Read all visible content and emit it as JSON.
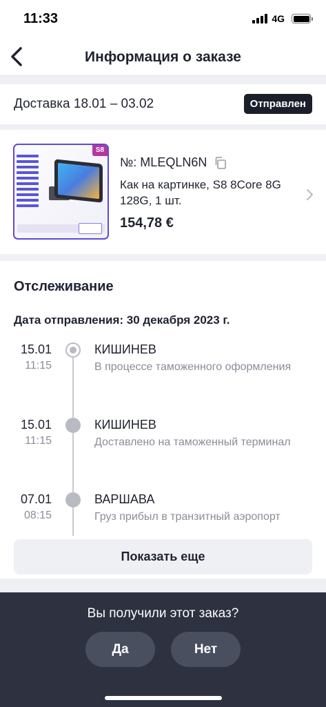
{
  "status_bar": {
    "time": "11:33",
    "network": "4G"
  },
  "nav": {
    "title": "Информация о заказе",
    "back_icon": "chevron-left-icon"
  },
  "delivery": {
    "text": "Доставка 18.01 – 03.02",
    "status": "Отправлен"
  },
  "product": {
    "thumb_badge": "S8",
    "order_number": "№: MLEQLN6N",
    "title": "Как на картинке, S8 8Core 8G 128G, 1 шт.",
    "price": "154,78 €"
  },
  "tracking": {
    "title": "Отслеживание",
    "ship_date": "Дата отправления: 30 декабря 2023 г.",
    "events": [
      {
        "date": "15.01",
        "time": "11:15",
        "city": "КИШИНЕВ",
        "description": "В процессе таможенного оформления"
      },
      {
        "date": "15.01",
        "time": "11:15",
        "city": "КИШИНЕВ",
        "description": "Доставлено на таможенный терминал"
      },
      {
        "date": "07.01",
        "time": "08:15",
        "city": "ВАРШАВА",
        "description": "Груз прибыл в транзитный аэропорт"
      }
    ],
    "show_more": "Показать еще"
  },
  "confirm": {
    "question": "Вы получили этот заказ?",
    "yes": "Да",
    "no": "Нет"
  },
  "colors": {
    "accent_dark": "#1b1f2a",
    "panel": "#2d3140",
    "muted_text": "#8a8d98"
  }
}
